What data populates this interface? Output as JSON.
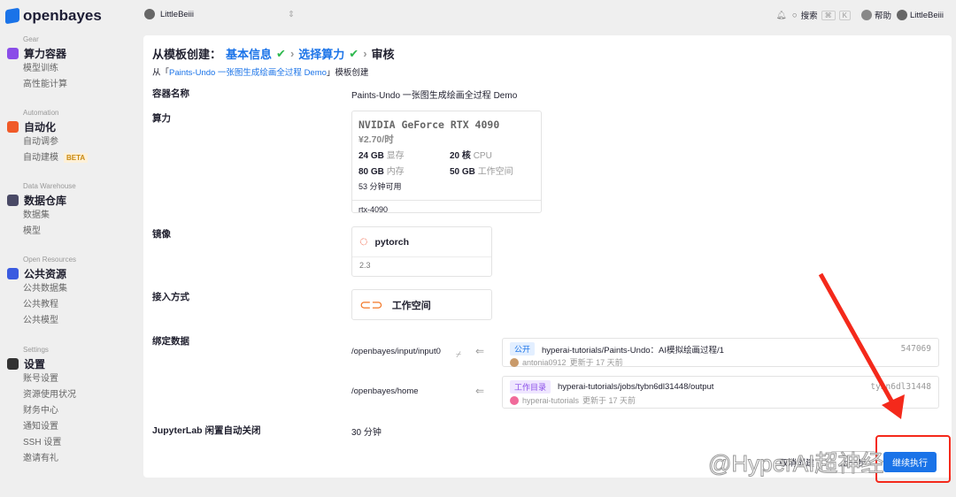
{
  "brand": "openbayes",
  "sidebar": [
    {
      "en": "Gear",
      "title": "算力容器",
      "color": "#8a4de8",
      "items": [
        "模型训练",
        "高性能计算"
      ]
    },
    {
      "en": "Automation",
      "title": "自动化",
      "color": "#f05a28",
      "items": [
        "自动调参",
        "自动建模"
      ],
      "badge": "BETA"
    },
    {
      "en": "Data Warehouse",
      "title": "数据仓库",
      "color": "#4a4a66",
      "items": [
        "数据集",
        "模型"
      ]
    },
    {
      "en": "Open Resources",
      "title": "公共资源",
      "color": "#3a5be0",
      "items": [
        "公共数据集",
        "公共教程",
        "公共模型"
      ]
    },
    {
      "en": "Settings",
      "title": "设置",
      "color": "#333",
      "items": [
        "账号设置",
        "资源使用状况",
        "财务中心",
        "通知设置",
        "SSH 设置",
        "邀请有礼"
      ]
    }
  ],
  "topbar": {
    "workspace": "LittleBeiii",
    "search": "搜索",
    "kbd1": "⌘",
    "kbd2": "K",
    "help": "帮助",
    "user": "LittleBeiii"
  },
  "header": {
    "prefix": "从模板创建：",
    "step1": "基本信息",
    "step2": "选择算力",
    "step3": "审核",
    "sub_pre": "从「",
    "sub_link": "Paints-Undo 一张图生成绘画全过程 Demo",
    "sub_post": "」模板创建"
  },
  "fields": {
    "name_label": "容器名称",
    "name_value": "Paints-Undo 一张图生成绘画全过程 Demo",
    "compute_label": "算力",
    "gpu": "NVIDIA GeForce RTX 4090",
    "price": "¥2.70/时",
    "specs": [
      {
        "v": "24 GB",
        "k": "显存"
      },
      {
        "v": "20 核",
        "k": "CPU"
      },
      {
        "v": "80 GB",
        "k": "内存"
      },
      {
        "v": "50 GB",
        "k": "工作空间"
      }
    ],
    "available": "53 分钟可用",
    "gpu_id": "rtx-4090",
    "image_label": "镜像",
    "image_name": "pytorch",
    "image_version": "2.3",
    "access_label": "接入方式",
    "access_value": "工作空间",
    "bind_label": "绑定数据",
    "bindings": [
      {
        "path": "/openbayes/input/input0",
        "tag": "公开",
        "name": "hyperai-tutorials/Paints-Undo：AI模拟绘画过程/1",
        "id": "547069",
        "user": "antonia0912",
        "updated": "更新于 17 天前"
      },
      {
        "path": "/openbayes/home",
        "tag": "工作目录",
        "name": "hyperai-tutorials/jobs/tybn6dl31448/output",
        "id": "tybn6dl31448",
        "user": "hyperai-tutorials",
        "updated": "更新于 17 天前"
      }
    ],
    "idle_label": "JupyterLab 闲置自动关闭",
    "idle_value": "30 分钟"
  },
  "actions": {
    "cancel": "取消创建",
    "prev": "上一步",
    "submit": "继续执行"
  },
  "watermark": "@HyperAI超神经"
}
